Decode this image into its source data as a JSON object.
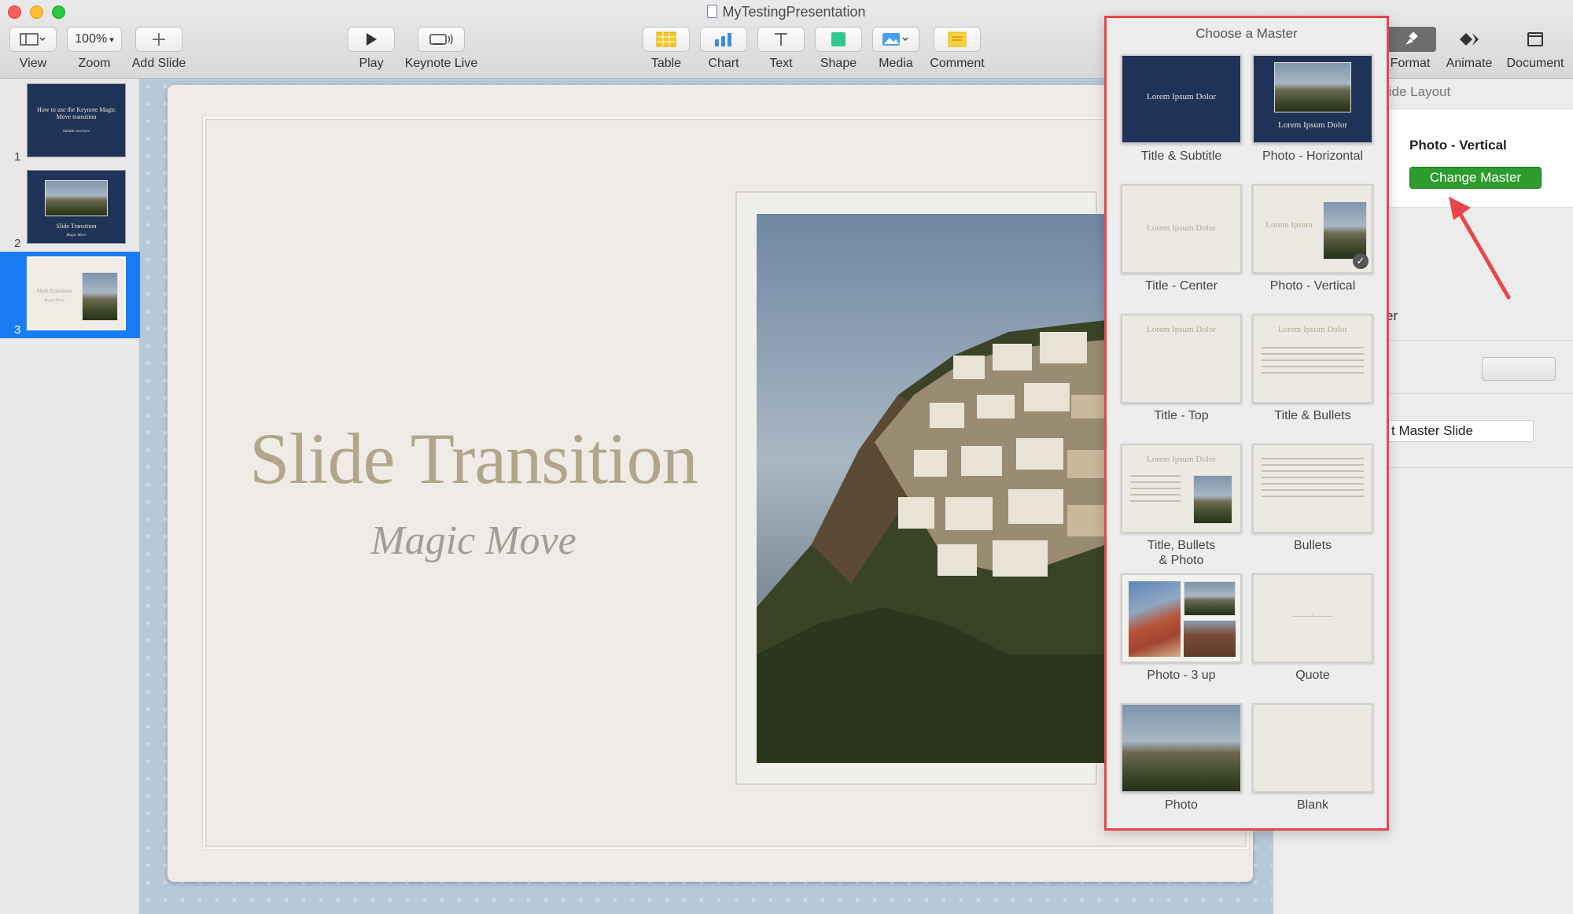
{
  "window": {
    "title": "MyTestingPresentation"
  },
  "toolbar": {
    "view": {
      "label": "View"
    },
    "zoom": {
      "value": "100%",
      "label": "Zoom"
    },
    "add_slide": {
      "label": "Add Slide"
    },
    "play": {
      "label": "Play"
    },
    "keynote_live": {
      "label": "Keynote Live"
    },
    "table": {
      "label": "Table"
    },
    "chart": {
      "label": "Chart"
    },
    "text": {
      "label": "Text"
    },
    "shape": {
      "label": "Shape"
    },
    "media": {
      "label": "Media"
    },
    "comment": {
      "label": "Comment"
    }
  },
  "inspector_tabs": [
    {
      "label": "Format",
      "icon": "paintbrush-icon",
      "active": true
    },
    {
      "label": "Animate",
      "icon": "diamond-icon",
      "active": false
    },
    {
      "label": "Document",
      "icon": "document-icon",
      "active": false
    }
  ],
  "navigator": {
    "slides": [
      {
        "num": "1",
        "title": "How to use the Keynote Magic Move transition",
        "sub": "Subtitle text here",
        "style": "dark"
      },
      {
        "num": "2",
        "title": "Slide Transition",
        "sub": "Magic Move",
        "style": "dark-photo"
      },
      {
        "num": "3",
        "title": "Slide Transition",
        "sub": "Magic Move",
        "style": "light-photo",
        "selected": true
      }
    ]
  },
  "slide": {
    "title": "Slide Transition",
    "subtitle": "Magic Move"
  },
  "inspector": {
    "section_label": "lide Layout",
    "master_name": "Photo - Vertical",
    "change_master": "Change Master",
    "partial_text": "er",
    "edit_master": "t Master Slide"
  },
  "popover": {
    "title": "Choose a Master",
    "placeholder": "Lorem Ipsum Dolor",
    "placeholder_short": "Lorem Ipsum",
    "masters": [
      {
        "label": "Title & Subtitle"
      },
      {
        "label": "Photo - Horizontal"
      },
      {
        "label": "Title - Center"
      },
      {
        "label": "Photo - Vertical",
        "checked": true
      },
      {
        "label": "Title - Top"
      },
      {
        "label": "Title & Bullets"
      },
      {
        "label": "Title, Bullets\n& Photo"
      },
      {
        "label": "Bullets"
      },
      {
        "label": "Photo - 3 up"
      },
      {
        "label": "Quote"
      },
      {
        "label": "Photo"
      },
      {
        "label": "Blank"
      }
    ]
  },
  "colors": {
    "accent_selection": "#1a7cf5",
    "change_master_green": "#2d9b2d",
    "annotation_red": "#e8464a",
    "slide_title": "#b1a68b"
  }
}
